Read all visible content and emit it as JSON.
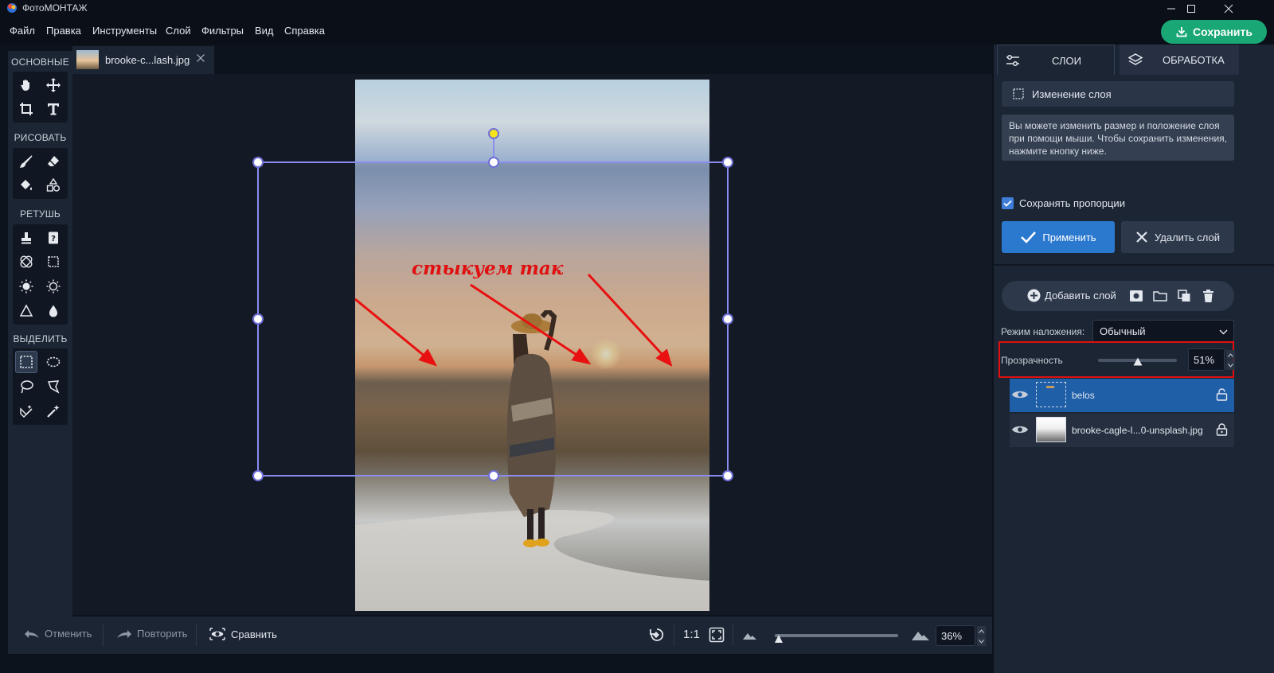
{
  "window": {
    "title": "ФотоМОНТАЖ"
  },
  "menu": [
    "Файл",
    "Правка",
    "Инструменты",
    "Слой",
    "Фильтры",
    "Вид",
    "Справка"
  ],
  "save_button": {
    "label": "Сохранить",
    "color": "#19a776"
  },
  "left_toolbar": {
    "sections": [
      "ОСНОВНЫЕ",
      "РИСОВАТЬ",
      "РЕТУШЬ",
      "ВЫДЕЛИТЬ"
    ],
    "tools": {
      "basic": [
        "hand-icon",
        "move-icon",
        "crop-icon",
        "text-icon"
      ],
      "draw": [
        "brush-icon",
        "eraser-icon",
        "fill-icon",
        "shapes-icon"
      ],
      "retouch": [
        "stamp-icon",
        "heal-icon",
        "patch-icon",
        "frame-icon",
        "brightness-icon",
        "light-icon",
        "sharpen-icon",
        "blur-icon"
      ],
      "select": [
        "rect-select-icon",
        "ellipse-select-icon",
        "lasso-icon",
        "poly-lasso-icon",
        "magic-eraser-icon",
        "magic-wand-icon"
      ]
    }
  },
  "doc_tab": {
    "name": "brooke-c...lash.jpg"
  },
  "canvas": {
    "annotation": "стыкуем так"
  },
  "bottom_bar": {
    "undo": "Отменить",
    "redo": "Повторить",
    "compare": "Сравнить",
    "ratio": "1:1",
    "zoom": "36%",
    "zoom_level": 0.03
  },
  "right_panel": {
    "tabs": [
      "СЛОИ",
      "ОБРАБОТКА"
    ],
    "layer_edit": "Изменение слоя",
    "info": "Вы можете изменить размер и положение слоя при помощи мыши. Чтобы сохранить изменения, нажмите кнопку ниже.",
    "keep_proportions": "Сохранять пропорции",
    "apply": "Применить",
    "delete": "Удалить слой",
    "add_layer": "Добавить слой",
    "blend_label": "Режим наложения:",
    "blend_value": "Обычный",
    "opacity_label": "Прозрачность",
    "opacity_value": "51%",
    "opacity_level": 0.51,
    "layers": [
      {
        "name": "belos",
        "selected": true
      },
      {
        "name": "brooke-cagle-I...0-unsplash.jpg",
        "selected": false
      }
    ]
  }
}
